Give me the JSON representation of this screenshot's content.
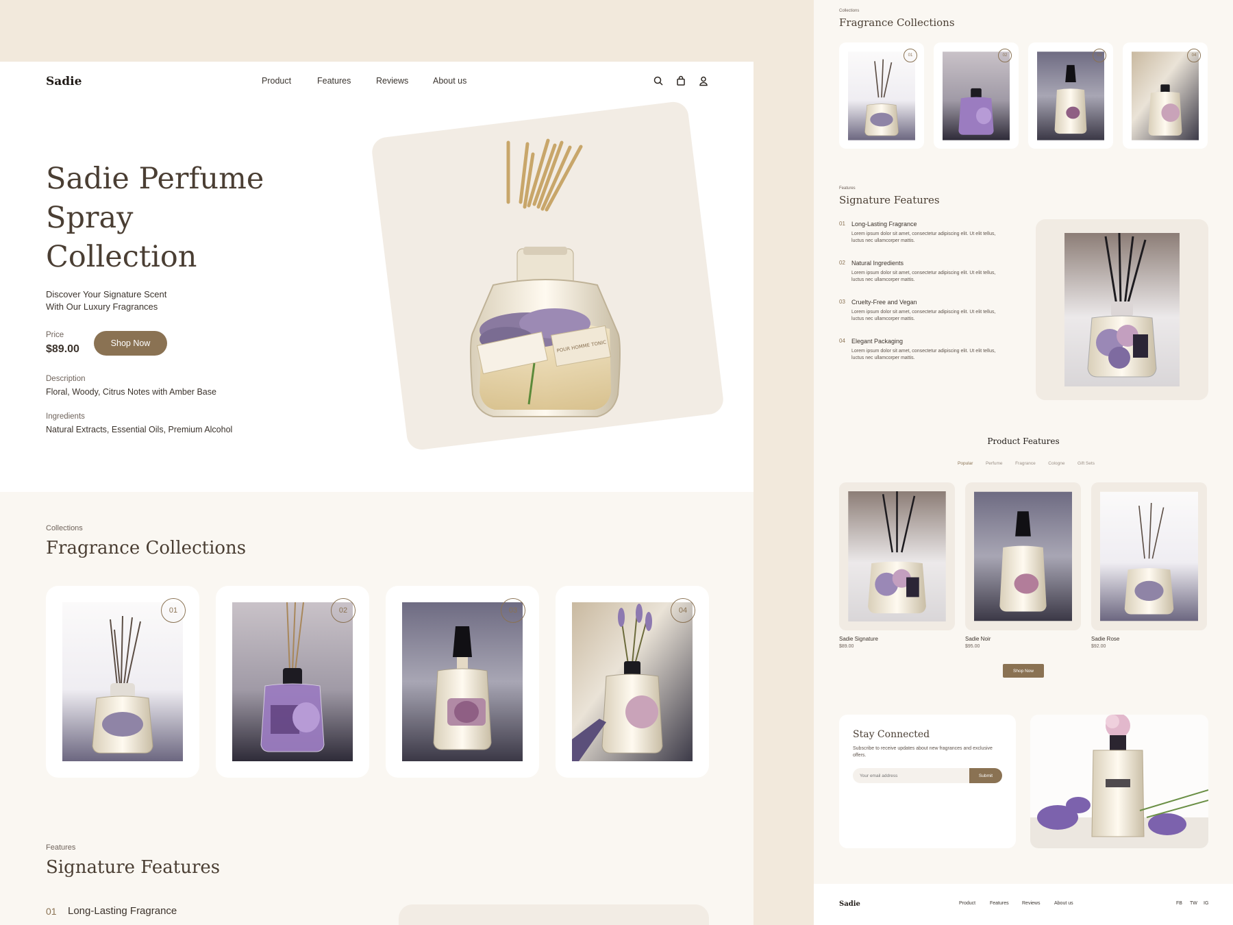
{
  "brand": "Sadie",
  "nav": [
    "Product",
    "Features",
    "Reviews",
    "About us"
  ],
  "hero": {
    "title": "Sadie Perfume Spray Collection",
    "subtitle_line1": "Discover Your Signature Scent",
    "subtitle_line2": "With Our Luxury Fragrances",
    "price_label": "Price",
    "price": "$89.00",
    "cta": "Shop Now",
    "description_label": "Description",
    "description": "Floral, Woody, Citrus Notes with Amber Base",
    "ingredients_label": "Ingredients",
    "ingredients": "Natural Extracts, Essential Oils, Premium Alcohol",
    "bottle_label": "POUR HOMME TONIC"
  },
  "collections": {
    "eyebrow": "Collections",
    "title": "Fragrance Collections",
    "items": [
      "01",
      "02",
      "03",
      "04"
    ]
  },
  "features": {
    "eyebrow": "Features",
    "title": "Signature Features",
    "items": [
      {
        "num": "01",
        "title": "Long-Lasting Fragrance",
        "text": "Lorem ipsum dolor sit amet, consectetur adipiscing elit. Ut elit tellus, luctus nec ullamcorper mattis."
      },
      {
        "num": "02",
        "title": "Natural Ingredients",
        "text": "Lorem ipsum dolor sit amet, consectetur adipiscing elit. Ut elit tellus, luctus nec ullamcorper mattis."
      },
      {
        "num": "03",
        "title": "Cruelty-Free and Vegan",
        "text": "Lorem ipsum dolor sit amet, consectetur adipiscing elit. Ut elit tellus, luctus nec ullamcorper mattis."
      },
      {
        "num": "04",
        "title": "Elegant Packaging",
        "text": "Lorem ipsum dolor sit amet, consectetur adipiscing elit. Ut elit tellus, luctus nec ullamcorper mattis."
      }
    ]
  },
  "product_features": {
    "title": "Product Features",
    "tabs": [
      "Popular",
      "Perfume",
      "Fragrance",
      "Cologne",
      "Gift Sets"
    ],
    "products": [
      {
        "name": "Sadie Signature",
        "price": "$89.00"
      },
      {
        "name": "Sadie Noir",
        "price": "$95.00"
      },
      {
        "name": "Sadie Rose",
        "price": "$92.00"
      }
    ],
    "cta": "Shop Now"
  },
  "newsletter": {
    "title": "Stay Connected",
    "text": "Subscribe to receive updates about new fragrances and exclusive offers.",
    "placeholder": "Your email address",
    "submit": "Submit"
  },
  "footer": {
    "brand": "Sadie",
    "links": [
      "Product",
      "Features",
      "Reviews",
      "About us"
    ],
    "social": [
      "FB",
      "TW",
      "IG"
    ]
  },
  "colors": {
    "accent": "#8a7253",
    "cream": "#f2e9dc",
    "dark_text": "#4a3e33"
  }
}
